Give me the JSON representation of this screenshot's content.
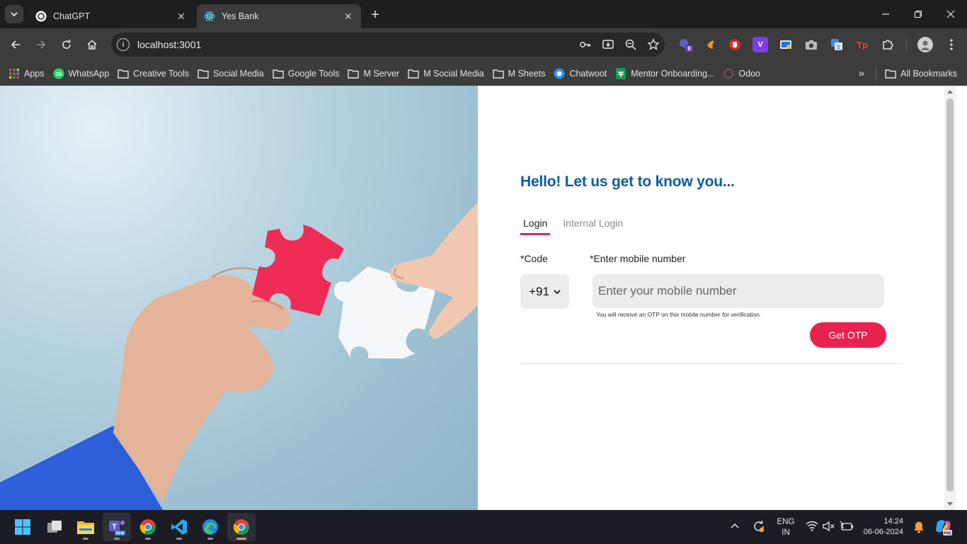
{
  "browser": {
    "tabs": [
      {
        "title": "ChatGPT",
        "active": false,
        "favicon": "chatgpt-icon"
      },
      {
        "title": "Yes Bank",
        "active": true,
        "favicon": "react-icon"
      }
    ],
    "url": "localhost:3001",
    "extensions": [
      {
        "name": "extension-teams-icon",
        "badge": "9"
      },
      {
        "name": "extension-orange-icon"
      },
      {
        "name": "extension-stop-icon"
      },
      {
        "name": "extension-v-icon",
        "label": "V"
      },
      {
        "name": "extension-screen-icon"
      },
      {
        "name": "extension-camera-icon"
      },
      {
        "name": "extension-translate-icon"
      },
      {
        "name": "extension-tp-icon",
        "label": "Tp"
      },
      {
        "name": "extensions-puzzle-icon"
      }
    ]
  },
  "bookmarks": {
    "items": [
      {
        "label": "Apps",
        "icon": "apps-grid-icon"
      },
      {
        "label": "WhatsApp",
        "icon": "whatsapp-icon",
        "badge": "26"
      },
      {
        "label": "Creative Tools",
        "icon": "folder-icon"
      },
      {
        "label": "Social Media",
        "icon": "folder-icon"
      },
      {
        "label": "Google Tools",
        "icon": "folder-icon"
      },
      {
        "label": "M Server",
        "icon": "folder-icon"
      },
      {
        "label": "M Social Media",
        "icon": "folder-icon"
      },
      {
        "label": "M Sheets",
        "icon": "folder-icon"
      },
      {
        "label": "Chatwoot",
        "icon": "chatwoot-icon"
      },
      {
        "label": "Mentor Onboarding...",
        "icon": "sheets-icon"
      },
      {
        "label": "Odoo",
        "icon": "odoo-icon"
      }
    ],
    "all_bookmarks": "All Bookmarks"
  },
  "page": {
    "greeting": "Hello! Let us get to know you...",
    "tabs": [
      {
        "label": "Login",
        "selected": true
      },
      {
        "label": "Internal Login",
        "selected": false
      }
    ],
    "code_label": "*Code",
    "code_value": "+91",
    "mobile_label": "*Enter mobile number",
    "mobile_placeholder": "Enter your mobile number",
    "mobile_value": "",
    "hint": "You will receive an OTP on this mobile number for verification",
    "otp_button": "Get OTP",
    "colors": {
      "heading": "#0f5ba2",
      "accent": "#e8224f"
    }
  },
  "taskbar": {
    "apps": [
      "windows-start-icon",
      "task-view-icon",
      "file-explorer-icon",
      "teams-new-icon",
      "chrome-icon",
      "vscode-icon",
      "edge-icon",
      "chrome-active-icon"
    ],
    "teams_badge": "NEW",
    "language": "ENG",
    "region": "IN",
    "time": "14:24",
    "date": "06-06-2024",
    "copilot_badge": "PRE"
  }
}
